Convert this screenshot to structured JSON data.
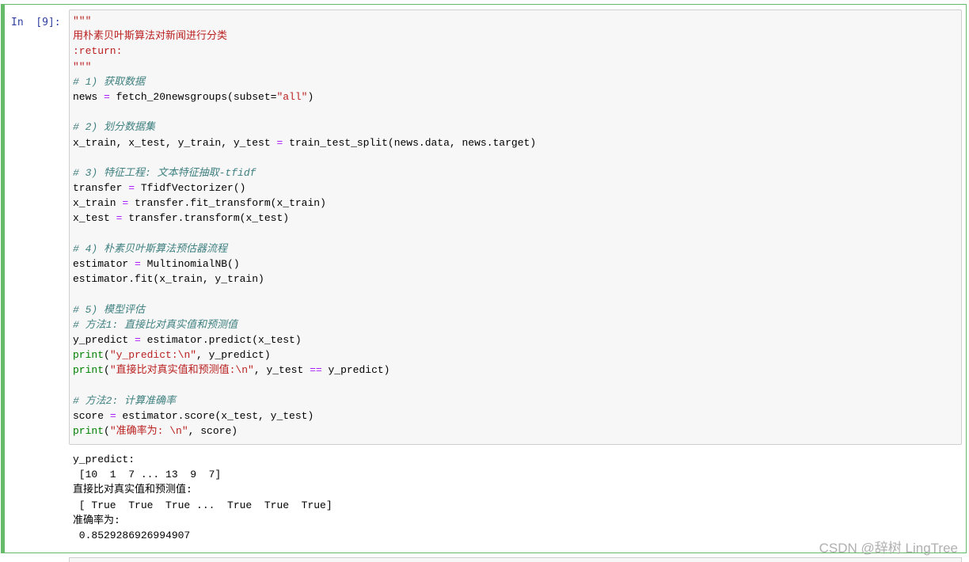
{
  "cell": {
    "prompt": "In  [9]:",
    "lines": [
      [
        [
          "str",
          "\"\"\""
        ]
      ],
      [
        [
          "str",
          "用朴素贝叶斯算法对新闻进行分类"
        ]
      ],
      [
        [
          "str",
          ":return:"
        ]
      ],
      [
        [
          "str",
          "\"\"\""
        ]
      ],
      [
        [
          "cm",
          "# 1) 获取数据"
        ]
      ],
      [
        [
          "t",
          "news "
        ],
        [
          "op",
          "="
        ],
        [
          "t",
          " fetch_20newsgroups(subset="
        ],
        [
          "str",
          "\"all\""
        ],
        [
          "t",
          ")"
        ]
      ],
      [],
      [
        [
          "cm",
          "# 2) 划分数据集"
        ]
      ],
      [
        [
          "t",
          "x_train, x_test, y_train, y_test "
        ],
        [
          "op",
          "="
        ],
        [
          "t",
          " train_test_split(news.data, news.target)"
        ]
      ],
      [],
      [
        [
          "cm",
          "# 3) 特征工程: 文本特征抽取-tfidf"
        ]
      ],
      [
        [
          "t",
          "transfer "
        ],
        [
          "op",
          "="
        ],
        [
          "t",
          " TfidfVectorizer()"
        ]
      ],
      [
        [
          "t",
          "x_train "
        ],
        [
          "op",
          "="
        ],
        [
          "t",
          " transfer.fit_transform(x_train)"
        ]
      ],
      [
        [
          "t",
          "x_test "
        ],
        [
          "op",
          "="
        ],
        [
          "t",
          " transfer.transform(x_test)"
        ]
      ],
      [],
      [
        [
          "cm",
          "# 4) 朴素贝叶斯算法预估器流程"
        ]
      ],
      [
        [
          "t",
          "estimator "
        ],
        [
          "op",
          "="
        ],
        [
          "t",
          " MultinomialNB()"
        ]
      ],
      [
        [
          "t",
          "estimator.fit(x_train, y_train)"
        ]
      ],
      [],
      [
        [
          "cm",
          "# 5) 模型评估"
        ]
      ],
      [
        [
          "cm",
          "# 方法1: 直接比对真实值和预测值"
        ]
      ],
      [
        [
          "t",
          "y_predict "
        ],
        [
          "op",
          "="
        ],
        [
          "t",
          " estimator.predict(x_test)"
        ]
      ],
      [
        [
          "kw",
          "print"
        ],
        [
          "t",
          "("
        ],
        [
          "str",
          "\"y_predict:\\n\""
        ],
        [
          "t",
          ", y_predict)"
        ]
      ],
      [
        [
          "kw",
          "print"
        ],
        [
          "t",
          "("
        ],
        [
          "str",
          "\"直接比对真实值和预测值:\\n\""
        ],
        [
          "t",
          ", y_test "
        ],
        [
          "op",
          "=="
        ],
        [
          "t",
          " y_predict)"
        ]
      ],
      [],
      [
        [
          "cm",
          "# 方法2: 计算准确率"
        ]
      ],
      [
        [
          "t",
          "score "
        ],
        [
          "op",
          "="
        ],
        [
          "t",
          " estimator.score(x_test, y_test)"
        ]
      ],
      [
        [
          "kw",
          "print"
        ],
        [
          "t",
          "("
        ],
        [
          "str",
          "\"准确率为: \\n\""
        ],
        [
          "t",
          ", score)"
        ]
      ]
    ]
  },
  "output": {
    "lines": [
      "y_predict:",
      " [10  1  7 ... 13  9  7]",
      "直接比对真实值和预测值:",
      " [ True  True  True ...  True  True  True]",
      "准确率为:",
      " 0.8529286926994907"
    ]
  },
  "watermark": "CSDN @辞树 LingTree",
  "colors": {
    "cell_border": "#66bb6a",
    "string": "#ba2121",
    "comment": "#408080",
    "operator": "#aa22ff",
    "builtin": "#008000",
    "prompt": "#303f9f"
  }
}
